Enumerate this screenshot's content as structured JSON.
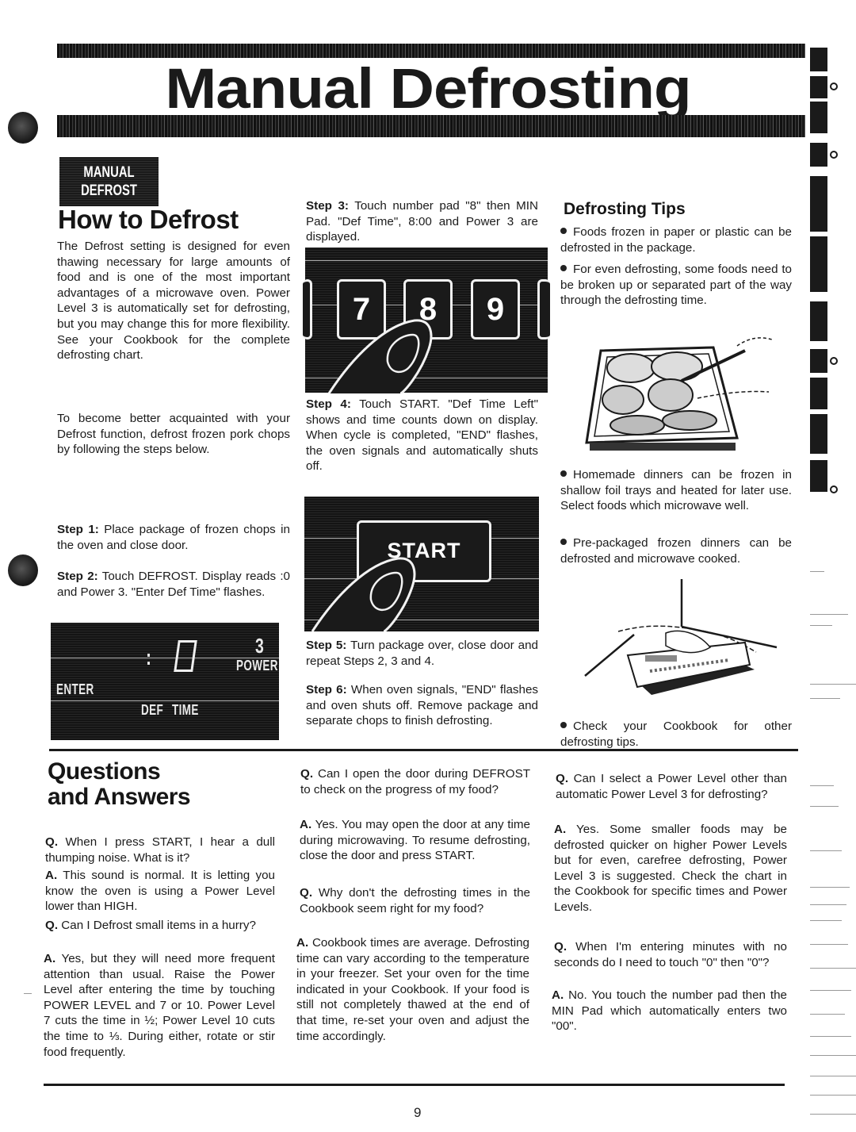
{
  "page": {
    "title": "Manual Defrosting",
    "page_number": "9"
  },
  "how_to": {
    "badge_line1": "MANUAL",
    "badge_line2": "DEFROST",
    "heading": "How to Defrost",
    "intro_p1": "The Defrost setting is designed for even thawing necessary for large amounts of food and is one of the most important advantages of a microwave oven. Power Level 3 is automatically set for defrosting, but you may change this for more flexibility. See your Cookbook for the complete defrosting chart.",
    "intro_p2": "To become better acquainted with your Defrost function, defrost frozen pork chops by following the steps below.",
    "steps": [
      {
        "label": "Step 1:",
        "text": "Place package of frozen chops in the oven and close door."
      },
      {
        "label": "Step 2:",
        "text": "Touch DEFROST. Display reads :0 and Power 3. \"Enter Def Time\" flashes."
      },
      {
        "label": "Step 3:",
        "text": "Touch number pad \"8\" then MIN Pad. \"Def Time\", 8:00 and Power 3 are displayed."
      },
      {
        "label": "Step 4:",
        "text": "Touch START. \"Def Time Left\" shows and time counts down on display. When cycle is completed, \"END\" flashes, the oven signals and automatically shuts off."
      },
      {
        "label": "Step 5:",
        "text": "Turn package over, close door and repeat Steps 2, 3 and 4."
      },
      {
        "label": "Step 6:",
        "text": "When oven signals, \"END\" flashes and oven shuts off. Remove package and separate chops to finish defrosting."
      }
    ],
    "display_panel": {
      "digits": ":0",
      "power_digit": "3",
      "label_enter": "ENTER",
      "label_power": "POWER",
      "label_def": "DEF",
      "label_time": "TIME"
    },
    "keypad": {
      "keys": [
        "7",
        "8",
        "9"
      ],
      "pressed_key": "8"
    },
    "start_key": {
      "label": "START"
    }
  },
  "tips": {
    "heading": "Defrosting Tips",
    "items": [
      "Foods frozen in paper or plastic can be defrosted in the package.",
      "For even defrosting, some foods need to be broken up or separated part of the way through the defrosting time.",
      "Homemade dinners can be frozen in shallow foil trays and heated for later use. Select foods which microwave well.",
      "Pre-packaged frozen dinners can be defrosted and microwave cooked.",
      "Check your Cookbook for other defrosting tips."
    ]
  },
  "qa": {
    "heading_line1": "Questions",
    "heading_line2": "and Answers",
    "q_label": "Q.",
    "a_label": "A.",
    "items": [
      {
        "q": "When I press START, I hear a dull thumping noise. What is it?",
        "a": "This sound is normal. It is letting you know the oven is using a Power Level lower than HIGH."
      },
      {
        "q": "Can I Defrost small items in a hurry?",
        "a": "Yes, but they will need more frequent attention than usual. Raise the Power Level after entering the time by touching POWER LEVEL and 7 or 10. Power Level 7 cuts the time in ½; Power Level 10 cuts the time to ⅓. During either, rotate or stir food frequently."
      },
      {
        "q": "Can I open the door during DEFROST to check on the progress of my food?",
        "a": "Yes. You may open the door at any time during microwaving. To resume defrosting, close the door and press START."
      },
      {
        "q": "Why don't the defrosting times in the Cookbook seem right for my food?",
        "a": "Cookbook times are average. Defrosting time can vary according to the temperature in your freezer. Set your oven for the time indicated in your Cookbook. If your food is still not completely thawed at the end of that time, re-set your oven and adjust the time accordingly."
      },
      {
        "q": "Can I select a Power Level other than automatic Power Level 3 for defrosting?",
        "a": "Yes. Some smaller foods may be defrosted quicker on higher Power Levels but for even, carefree defrosting, Power Level 3 is suggested. Check the chart in the Cookbook for specific times and Power Levels."
      },
      {
        "q": "When I'm entering minutes with no seconds do I need to touch \"0\" then \"0\"?",
        "a": "No. You touch the number pad then the MIN Pad which automatically enters two \"00\"."
      }
    ]
  }
}
